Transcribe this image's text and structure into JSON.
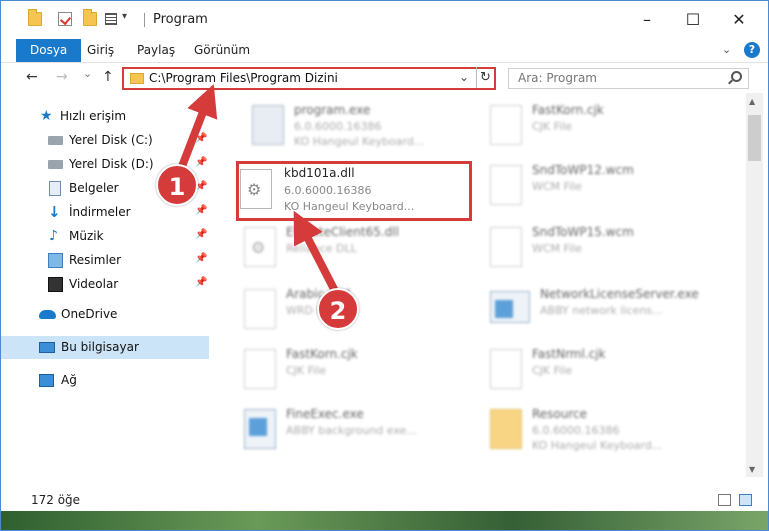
{
  "window": {
    "title": "Program",
    "controls": {
      "minimize": "–",
      "maximize": "☐",
      "close": "✕"
    }
  },
  "ribbon": {
    "tabs": [
      "Dosya",
      "Giriş",
      "Paylaş",
      "Görünüm"
    ],
    "expand_icon": "chevron-down-icon",
    "help": "?"
  },
  "nav": {
    "back": "←",
    "forward": "→",
    "recent": "⌄",
    "up": "↑",
    "address": "C:\\Program Files\\Program Dizini",
    "address_dropdown": "⌄",
    "refresh": "↻",
    "search_placeholder": "Ara: Program"
  },
  "sidebar": {
    "items": [
      {
        "label": "Hızlı erişim",
        "icon": "star-icon",
        "pinned": false
      },
      {
        "label": "Yerel Disk (C:)",
        "icon": "disk-icon",
        "pinned": true
      },
      {
        "label": "Yerel Disk (D:)",
        "icon": "disk-icon",
        "pinned": true
      },
      {
        "label": "Belgeler",
        "icon": "documents-icon",
        "pinned": true
      },
      {
        "label": "İndirmeler",
        "icon": "download-icon",
        "pinned": true
      },
      {
        "label": "Müzik",
        "icon": "music-icon",
        "pinned": true
      },
      {
        "label": "Resimler",
        "icon": "pictures-icon",
        "pinned": true
      },
      {
        "label": "Videolar",
        "icon": "videos-icon",
        "pinned": true
      },
      {
        "label": "OneDrive",
        "icon": "cloud-icon",
        "pinned": false
      },
      {
        "label": "Bu bilgisayar",
        "icon": "computer-icon",
        "pinned": false,
        "selected": true
      },
      {
        "label": "Ağ",
        "icon": "network-icon",
        "pinned": false
      }
    ]
  },
  "files": {
    "left": [
      {
        "name": "program.exe",
        "line1": "6.0.6000.16386",
        "line2": "KO Hangeul Keyboard...",
        "icon": "exe"
      },
      {
        "name": "kbd101a.dll",
        "line1": "6.0.6000.16386",
        "line2": "KO Hangeul Keyboard...",
        "icon": "dll",
        "highlighted": true
      },
      {
        "name": "ElevateClient65.dll",
        "line1": "Reliance DLL",
        "line2": "",
        "icon": "dll"
      },
      {
        "name": "Arabic.wrd",
        "line1": "WRD File",
        "line2": "",
        "icon": "file"
      },
      {
        "name": "FastKorn.cjk",
        "line1": "CJK File",
        "line2": "",
        "icon": "file"
      },
      {
        "name": "FineExec.exe",
        "line1": "ABBY background exe...",
        "line2": "",
        "icon": "net"
      }
    ],
    "right": [
      {
        "name": "FastKorn.cjk",
        "line1": "CJK File",
        "line2": "",
        "icon": "file"
      },
      {
        "name": "SndToWP12.wcm",
        "line1": "WCM File",
        "line2": "",
        "icon": "file"
      },
      {
        "name": "SndToWP15.wcm",
        "line1": "WCM File",
        "line2": "",
        "icon": "file"
      },
      {
        "name": "NetworkLicenseServer.exe",
        "line1": "ABBY network licens...",
        "line2": "",
        "icon": "net"
      },
      {
        "name": "FastNrml.cjk",
        "line1": "CJK File",
        "line2": "",
        "icon": "file"
      },
      {
        "name": "Resource",
        "line1": "6.0.6000.16386",
        "line2": "KO Hangeul Keyboard...",
        "icon": "folder"
      }
    ]
  },
  "status": {
    "count": "172 öğe"
  },
  "annotations": {
    "step1": "1",
    "step2": "2",
    "color": "#d53b3b"
  }
}
